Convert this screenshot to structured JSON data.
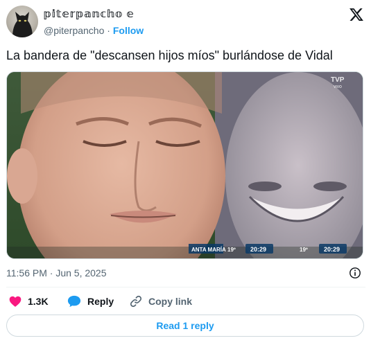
{
  "header": {
    "display_name": "𝕡𝕚𝕥𝕖𝕣𝕡𝕒𝕟𝕔𝕙𝕠 𝕖",
    "handle": "@piterpancho",
    "separator": "·",
    "follow_label": "Follow",
    "avatar_icon": "cat-avatar-icon",
    "logo_icon": "x-logo-icon"
  },
  "tweet": {
    "text": "La bandera de \"descansen hijos míos\" burlándose de Vidal"
  },
  "media": {
    "overlay": {
      "left_caption": "ANTA MARÍA",
      "left_number": "19º",
      "left_time": "20:29",
      "right_number": "19º",
      "right_time": "20:29",
      "channel": "TVP",
      "channel_sub": "VIVO"
    }
  },
  "meta": {
    "timestamp": "11:56 PM · Jun 5, 2025"
  },
  "actions": {
    "like_count": "1.3K",
    "reply_label": "Reply",
    "copy_label": "Copy link"
  },
  "read_replies_label": "Read 1 reply",
  "colors": {
    "accent": "#1d9bf0",
    "like": "#f91880",
    "text": "#0f1419",
    "secondary": "#536471"
  }
}
